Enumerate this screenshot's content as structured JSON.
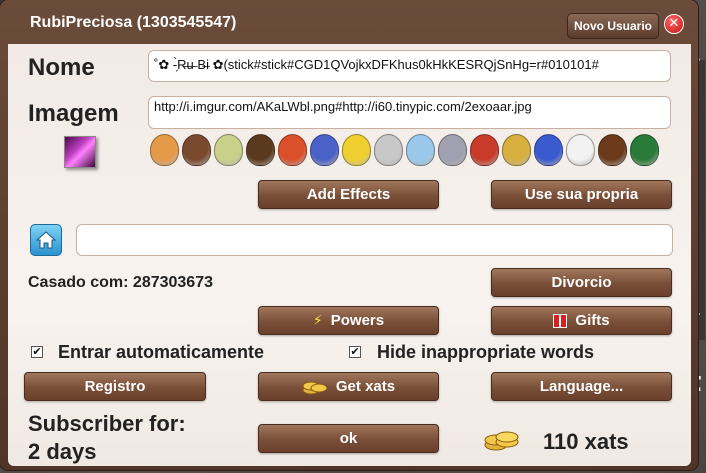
{
  "dialog": {
    "title": "RubiPreciosa (1303545547)",
    "new_user_label": "Novo Usuario",
    "close_glyph": "✕"
  },
  "name": {
    "label": "Nome",
    "value": "˚✿ -̗̀R̶u̶ B̶i ✿(stick#stick#CGD1QVojkxDFKhus0kHkKESRQjSnHg=r#010101#"
  },
  "image": {
    "label": "Imagem",
    "value": "http://i.imgur.com/AKaLWbl.png#http://i60.tinypic.com/2exoaar.jpg"
  },
  "avatars": {
    "colors": [
      "#e59a4a",
      "#7a4a2e",
      "#c9d08a",
      "#5a3a1e",
      "#d9502a",
      "#4a62c8",
      "#f0d030",
      "#c8c8c8",
      "#9ac8ea",
      "#a0a0b0",
      "#c83a2a",
      "#d8b040",
      "#3a5ad0",
      "#f2f2f2",
      "#6a3a1a",
      "#2a7a3a"
    ]
  },
  "buttons": {
    "add_effects": "Add Effects",
    "use_own": "Use sua  propria",
    "divorce": "Divorcio",
    "powers": "Powers",
    "gifts": "Gifts",
    "register": "Registro",
    "get_xats": "Get xats",
    "language": "Language...",
    "ok": "ok"
  },
  "homepage": {
    "value": ""
  },
  "married": {
    "text": "Casado com: 287303673"
  },
  "options": {
    "auto_login": {
      "label": "Entrar automaticamente",
      "checked": true
    },
    "hide_words": {
      "label": "Hide inappropriate words",
      "checked": true
    },
    "check_glyph": "✔"
  },
  "subscriber": {
    "line1": "Subscriber for:",
    "line2": "2 days"
  },
  "balance": {
    "text": "110 xats"
  },
  "background": {
    "scroll_up": "▲",
    "scroll_down": "▼",
    "letter": "t"
  }
}
